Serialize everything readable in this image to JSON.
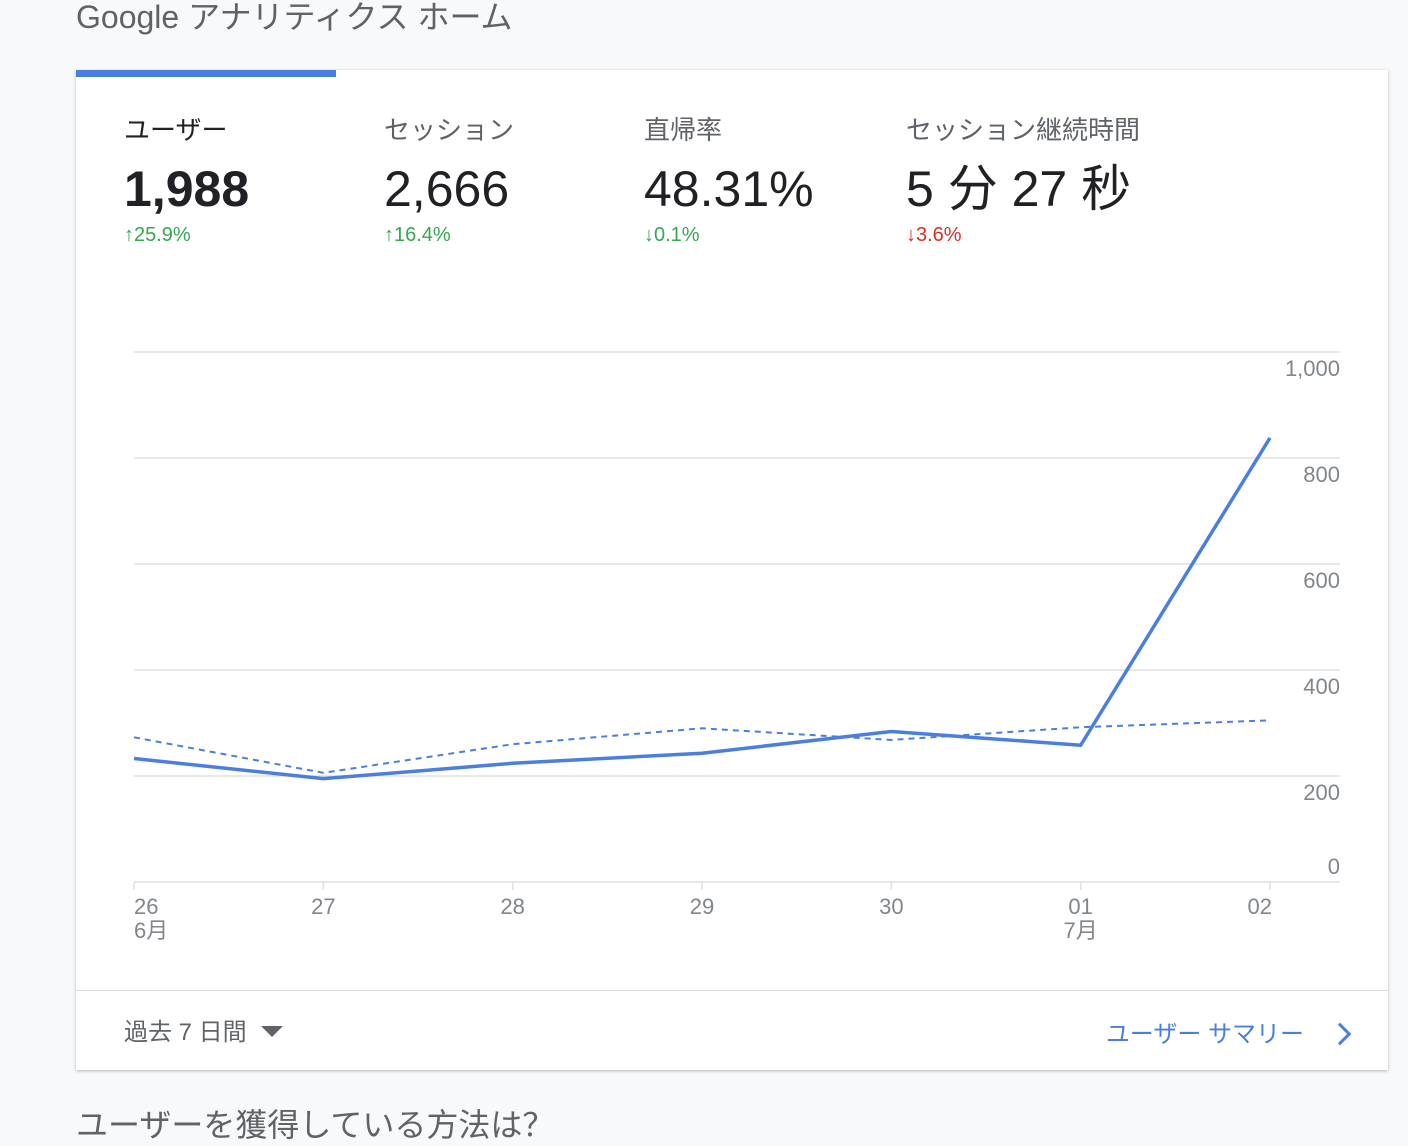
{
  "page": {
    "title": "Google アナリティクス ホーム",
    "next_section_heading": "ユーザーを獲得している方法は？"
  },
  "metrics": [
    {
      "label": "ユーザー",
      "value": "1,988",
      "change": "25.9%",
      "direction": "up",
      "active": true
    },
    {
      "label": "セッション",
      "value": "2,666",
      "change": "16.4%",
      "direction": "up",
      "active": false
    },
    {
      "label": "直帰率",
      "value": "48.31%",
      "change": "0.1%",
      "direction": "down-good",
      "active": false
    },
    {
      "label": "セッション継続時間",
      "value": "5 分 27 秒",
      "change": "3.6%",
      "direction": "down-bad",
      "active": false
    }
  ],
  "icons": {
    "arrow_up": "↑",
    "arrow_down": "↓"
  },
  "footer": {
    "date_range": "過去 7 日間",
    "summary_link": "ユーザー サマリー"
  },
  "colors": {
    "accent": "#4a7fe0",
    "positive": "#34a853",
    "negative": "#d93025",
    "grid": "#e0e0e0",
    "axis_text": "#80868b"
  },
  "chart_data": {
    "type": "line",
    "x": [
      "26",
      "27",
      "28",
      "29",
      "30",
      "01",
      "02"
    ],
    "x_sublabels": [
      "6月",
      "",
      "",
      "",
      "",
      "7月",
      ""
    ],
    "series": [
      {
        "values": [
          233,
          195,
          224,
          243,
          284,
          258,
          838
        ],
        "style": "solid"
      },
      {
        "values": [
          273,
          206,
          260,
          290,
          268,
          292,
          305
        ],
        "style": "dashed"
      }
    ],
    "ylim": [
      0,
      1000
    ],
    "yticks": [
      "0",
      "200",
      "400",
      "600",
      "800",
      "1,000"
    ],
    "grid": true,
    "legend": "none"
  }
}
